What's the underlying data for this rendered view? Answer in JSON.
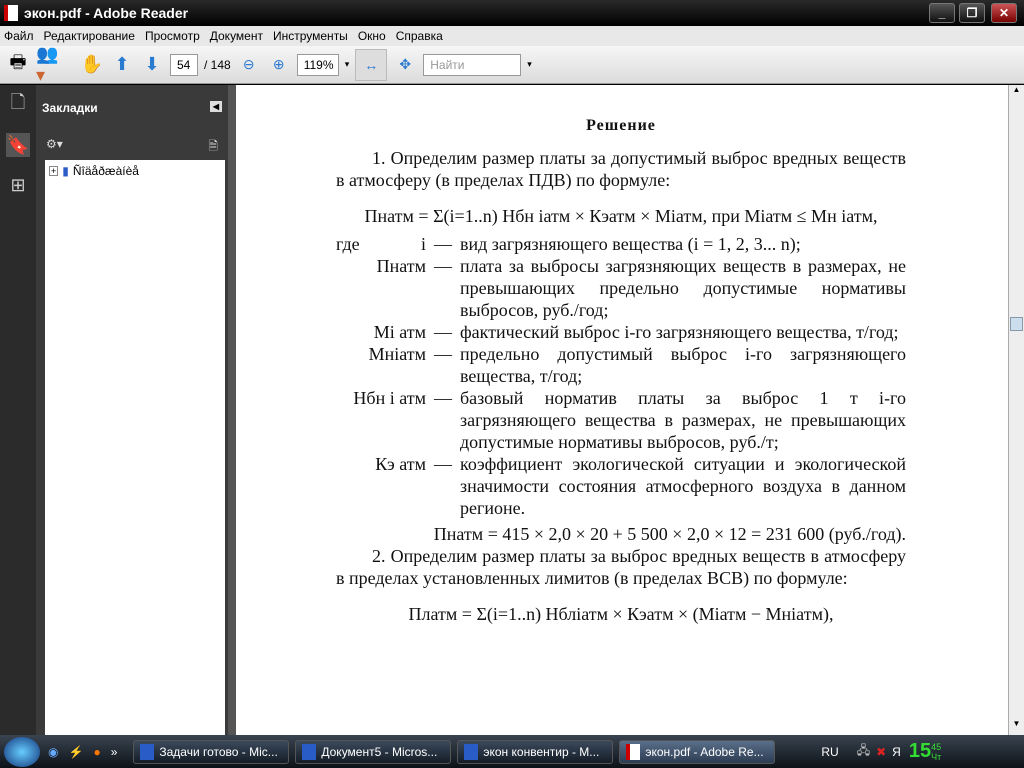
{
  "window": {
    "title": "экон.pdf - Adobe Reader"
  },
  "menu": [
    "Файл",
    "Редактирование",
    "Просмотр",
    "Документ",
    "Инструменты",
    "Окно",
    "Справка"
  ],
  "toolbar": {
    "page": "54",
    "page_total": "/ 148",
    "zoom": "119%",
    "search_placeholder": "Найти"
  },
  "bookmarks": {
    "title": "Закладки",
    "items": [
      "Ñîäåðæàíèå"
    ]
  },
  "document": {
    "heading": "Решение",
    "p1": "1. Определим размер платы за допустимый выброс вредных веществ в атмосферу (в пределах ПДВ) по формуле:",
    "formula1": "Пнатм = Σ(i=1..n) Нбн iатм × Кэатм × Мiатм, при Мiатм ≤ Мн iатм,",
    "where": "где",
    "defs": [
      {
        "sym": "i",
        "text": "вид загрязняющего вещества (i = 1, 2, 3... n);"
      },
      {
        "sym": "Пнатм",
        "text": "плата за выбросы загрязняющих веществ в размерах, не превышающих предельно допустимые нормативы выбросов, руб./год;"
      },
      {
        "sym": "Мi атм",
        "text": "фактический выброс i-го загрязняющего вещества, т/год;"
      },
      {
        "sym": "Мнiатм",
        "text": "предельно допустимый выброс i-го загрязняющего вещества, т/год;"
      },
      {
        "sym": "Нбн i атм",
        "text": "базовый норматив платы за выброс 1 т i-го загрязняющего вещества в размерах, не превышающих допустимые нормативы выбросов, руб./т;"
      },
      {
        "sym": "Кэ атм",
        "text": "коэффициент экологической ситуации и экологической значимости состояния атмосферного воздуха в данном регионе."
      }
    ],
    "calc": "Пнатм = 415 × 2,0 × 20 + 5 500 × 2,0 × 12 = 231 600 (руб./год).",
    "p2": "2. Определим размер платы за выброс вредных веществ в атмосферу в пределах установленных лимитов (в пределах ВСВ) по формуле:",
    "formula2": "Платм = Σ(i=1..n) Нблiатм × Кэатм × (Мiатм − Мнiатм),"
  },
  "taskbar": {
    "tasks": [
      "Задачи готово - Mic...",
      "Документ5 - Micros...",
      "экон конвентир - M...",
      "экон.pdf - Adobe Re..."
    ],
    "lang": "RU",
    "time": "15",
    "minutes": "45",
    "day": "Чт"
  }
}
